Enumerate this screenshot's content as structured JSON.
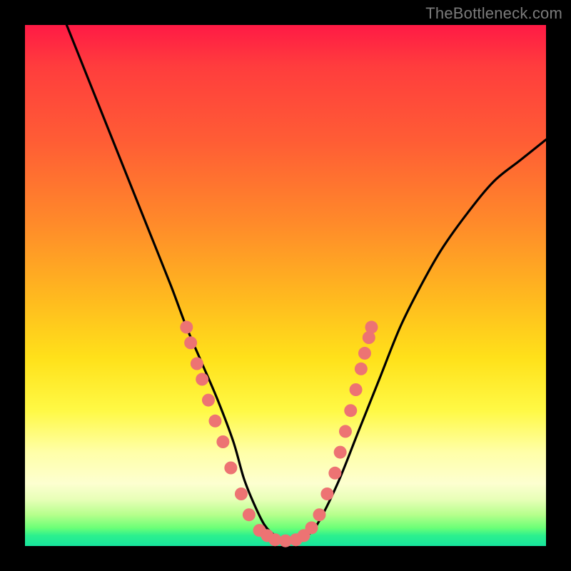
{
  "watermark": "TheBottleneck.com",
  "colors": {
    "background": "#000000",
    "curve_stroke": "#000000",
    "dot_fill": "#ed7373",
    "gradient_top": "#ff1a45",
    "gradient_bottom": "#17e59d"
  },
  "chart_data": {
    "type": "line",
    "title": "",
    "xlabel": "",
    "ylabel": "",
    "xlim": [
      0,
      100
    ],
    "ylim": [
      0,
      100
    ],
    "grid": false,
    "legend": false,
    "series": [
      {
        "name": "bottleneck-curve",
        "x": [
          8,
          12,
          16,
          20,
          24,
          28,
          31,
          34,
          37,
          40,
          42,
          44,
          46,
          48,
          50,
          52,
          54,
          56,
          60,
          64,
          68,
          72,
          76,
          80,
          85,
          90,
          95,
          100
        ],
        "y": [
          100,
          90,
          80,
          70,
          60,
          50,
          42,
          35,
          28,
          20,
          13,
          8,
          4,
          2,
          1,
          1,
          2,
          4,
          12,
          22,
          32,
          42,
          50,
          57,
          64,
          70,
          74,
          78
        ]
      }
    ],
    "markers": [
      {
        "name": "highlight-dots",
        "points": [
          {
            "x": 31.0,
            "y": 42
          },
          {
            "x": 31.8,
            "y": 39
          },
          {
            "x": 33.0,
            "y": 35
          },
          {
            "x": 34.0,
            "y": 32
          },
          {
            "x": 35.2,
            "y": 28
          },
          {
            "x": 36.5,
            "y": 24
          },
          {
            "x": 38.0,
            "y": 20
          },
          {
            "x": 39.5,
            "y": 15
          },
          {
            "x": 41.5,
            "y": 10
          },
          {
            "x": 43.0,
            "y": 6
          },
          {
            "x": 45.0,
            "y": 3
          },
          {
            "x": 46.5,
            "y": 2
          },
          {
            "x": 48.0,
            "y": 1.2
          },
          {
            "x": 50.0,
            "y": 1
          },
          {
            "x": 52.0,
            "y": 1.2
          },
          {
            "x": 53.5,
            "y": 2
          },
          {
            "x": 55.0,
            "y": 3.5
          },
          {
            "x": 56.5,
            "y": 6
          },
          {
            "x": 58.0,
            "y": 10
          },
          {
            "x": 59.5,
            "y": 14
          },
          {
            "x": 60.5,
            "y": 18
          },
          {
            "x": 61.5,
            "y": 22
          },
          {
            "x": 62.5,
            "y": 26
          },
          {
            "x": 63.5,
            "y": 30
          },
          {
            "x": 64.5,
            "y": 34
          },
          {
            "x": 65.2,
            "y": 37
          },
          {
            "x": 66.0,
            "y": 40
          },
          {
            "x": 66.5,
            "y": 42
          }
        ]
      }
    ]
  }
}
